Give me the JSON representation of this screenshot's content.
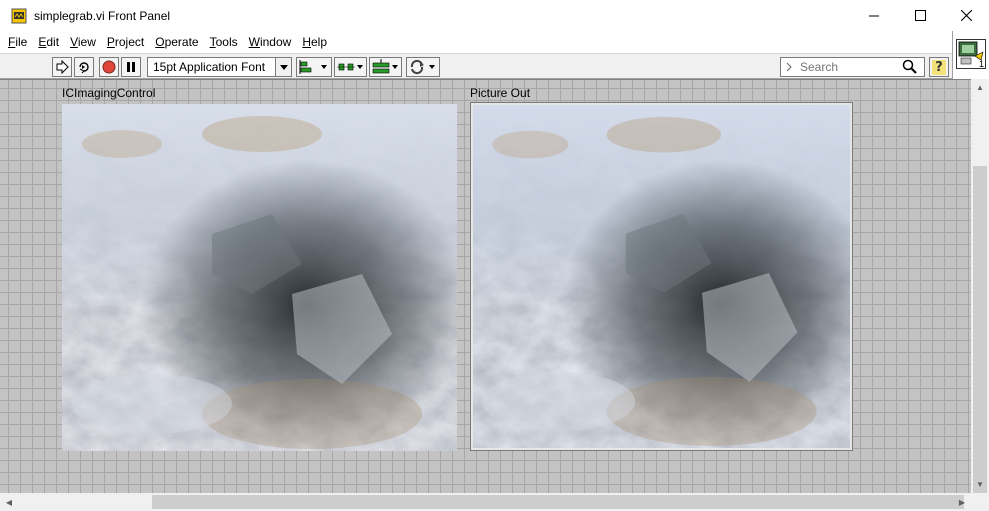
{
  "window": {
    "title": "simplegrab.vi Front Panel",
    "minimize_icon": "minimize-icon",
    "maximize_icon": "maximize-icon",
    "close_icon": "close-icon"
  },
  "menu": {
    "items": [
      {
        "label": "File",
        "key": "F",
        "rest": "ile"
      },
      {
        "label": "Edit",
        "key": "E",
        "rest": "dit"
      },
      {
        "label": "View",
        "key": "V",
        "rest": "iew"
      },
      {
        "label": "Project",
        "key": "P",
        "rest": "roject"
      },
      {
        "label": "Operate",
        "key": "O",
        "rest": "perate"
      },
      {
        "label": "Tools",
        "key": "T",
        "rest": "ools"
      },
      {
        "label": "Window",
        "key": "W",
        "rest": "indow"
      },
      {
        "label": "Help",
        "key": "H",
        "rest": "elp"
      }
    ]
  },
  "toolbar": {
    "font_value": "15pt Application Font",
    "search_placeholder": "Search",
    "help_label": "?",
    "vi_icon_number": "1"
  },
  "panel": {
    "control1_label": "ICImagingControl",
    "control2_label": "Picture Out"
  },
  "colors": {
    "canvas_bg": "#c3c3c3",
    "grid": "#a6a6a6",
    "run_button_accent": "#e0453a"
  }
}
